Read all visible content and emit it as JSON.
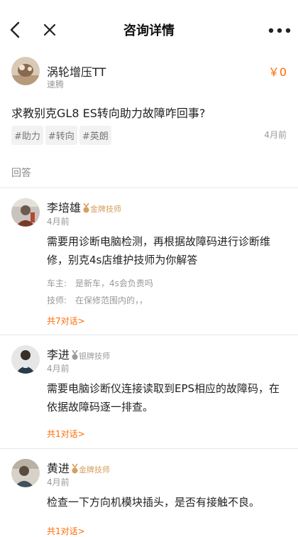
{
  "header": {
    "title": "咨询详情"
  },
  "asker": {
    "name": "涡轮增压TT",
    "car": "速腾",
    "price": "￥0"
  },
  "question": {
    "text": "求教别克GL8 ES转向助力故障咋回事?",
    "tags": [
      "#助力",
      "#转向",
      "#英朗"
    ],
    "time": "4月前"
  },
  "answers_label": "回答",
  "answers": [
    {
      "name": "李培雄",
      "title": "金牌技师",
      "title_color": "#d4a05f",
      "time": "4月前",
      "text": "需要用诊断电脑检测，再根据故障码进行诊断维修，别克4s店维护技师为你解答",
      "convo": [
        {
          "who": "车主:",
          "text": "是新车，4s会负责吗"
        },
        {
          "who": "技师:",
          "text": "在保修范围内的，，"
        }
      ],
      "link": "共7对话>"
    },
    {
      "name": "李进",
      "title": "银牌技师",
      "title_color": "#9b9b9b",
      "time": "4月前",
      "text": "需要电脑诊断仪连接读取到EPS相应的故障码，在依据故障码逐一排查。",
      "convo": [],
      "link": "共1对话>"
    },
    {
      "name": "黄进",
      "title": "金牌技师",
      "title_color": "#d4a05f",
      "time": "4月前",
      "text": "检查一下方向机模块插头，是否有接触不良。",
      "convo": [],
      "link": "共1对话>"
    }
  ]
}
